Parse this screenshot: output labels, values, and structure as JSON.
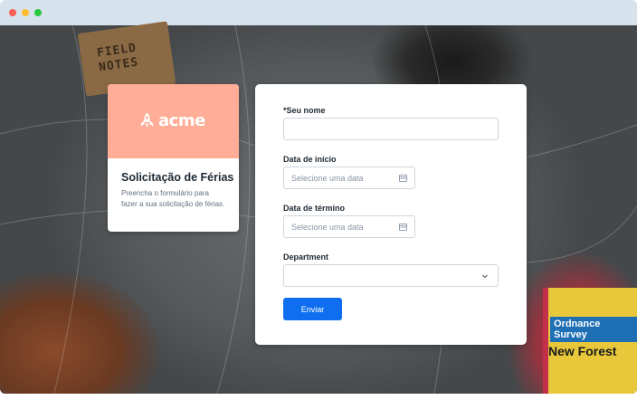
{
  "brand": {
    "logo_text": "acme",
    "title": "Solicitação de Férias",
    "description": "Preencha o formulário para fazer a sua solicitação de férias.",
    "banner_color": "#ffad96"
  },
  "background": {
    "notebook_text": "FIELD NOTES",
    "map_brand": "Ordnance Survey",
    "map_title": "New Forest"
  },
  "form": {
    "name_label": "*Seu nome",
    "name_value": "",
    "start_label": "Data de início",
    "start_placeholder": "Selecione uma data",
    "end_label": "Data de término",
    "end_placeholder": "Selecione uma data",
    "department_label": "Department",
    "department_value": "",
    "submit_label": "Enviar",
    "accent_color": "#0f6ef0"
  },
  "icons": {
    "calendar": "calendar-icon",
    "chevron": "chevron-down-icon",
    "logo": "rocket-icon"
  }
}
